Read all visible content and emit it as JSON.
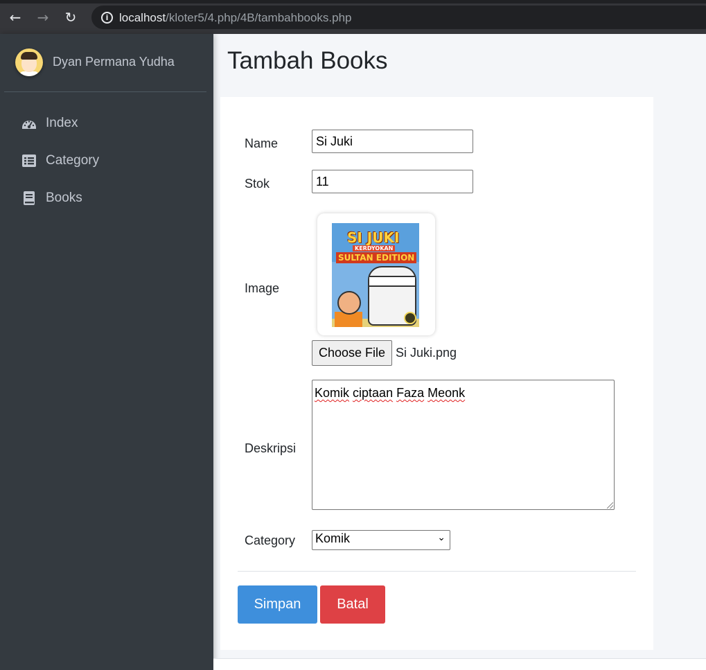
{
  "browser": {
    "url_host": "localhost",
    "url_path": "/kloter5/4.php/4B/tambahbooks.php"
  },
  "sidebar": {
    "user_name": "Dyan Permana Yudha",
    "items": [
      {
        "label": "Index",
        "icon": "dashboard-icon"
      },
      {
        "label": "Category",
        "icon": "list-icon"
      },
      {
        "label": "Books",
        "icon": "book-icon"
      }
    ]
  },
  "page": {
    "title": "Tambah Books"
  },
  "form": {
    "name_label": "Name",
    "name_value": "Si Juki",
    "stok_label": "Stok",
    "stok_value": "11",
    "image_label": "Image",
    "image_preview": {
      "line1": "SI JUKI",
      "line2": "KERDYOKAN",
      "line3": "SULTAN EDITION"
    },
    "file_button_label": "Choose File",
    "file_name": "Si Juki.png",
    "deskripsi_label": "Deskripsi",
    "deskripsi_words": [
      "Komik",
      "ciptaan",
      "Faza",
      "Meonk"
    ],
    "category_label": "Category",
    "category_selected": "Komik",
    "save_label": "Simpan",
    "cancel_label": "Batal"
  },
  "colors": {
    "sidebar_bg": "#343a40",
    "primary": "#3e8fdc",
    "danger": "#de4145"
  }
}
